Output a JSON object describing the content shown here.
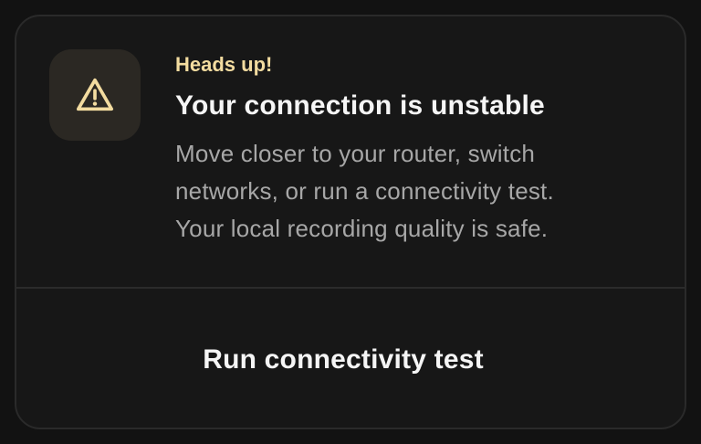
{
  "alert": {
    "icon": "warning-triangle-icon",
    "eyebrow": "Heads up!",
    "title": "Your connection is unstable",
    "body_lines": [
      "Move closer to your router, switch",
      "networks, or run a connectivity test.",
      "Your local recording quality is safe."
    ],
    "action_label": "Run connectivity test"
  },
  "colors": {
    "background": "#121212",
    "card": "#171717",
    "icon_tile": "#2b2823",
    "accent": "#f3dca0",
    "title": "#f5f5f5",
    "body": "#a7a7a7",
    "divider": "#2b2b2b"
  }
}
